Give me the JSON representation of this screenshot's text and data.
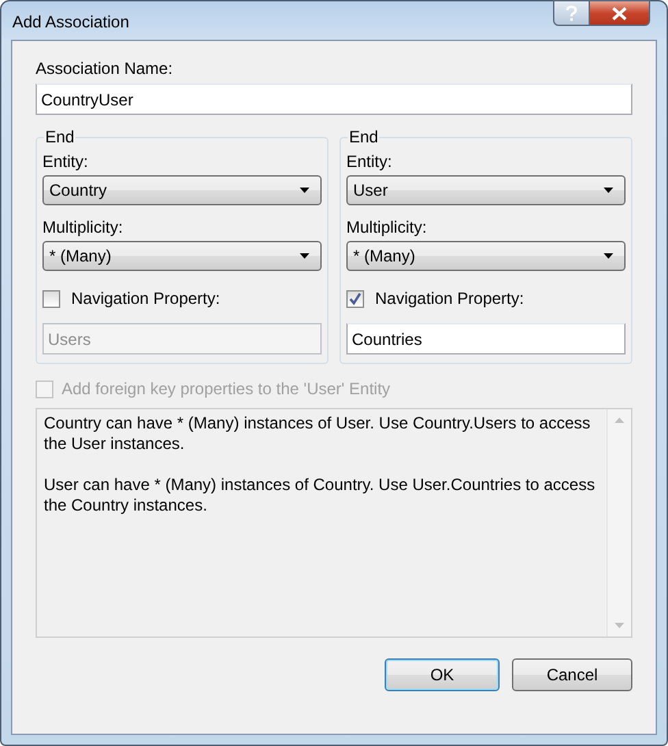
{
  "window": {
    "title": "Add Association"
  },
  "association_name": {
    "label": "Association Name:",
    "value": "CountryUser"
  },
  "ends": [
    {
      "legend": "End",
      "entity_label": "Entity:",
      "entity": "Country",
      "multiplicity_label": "Multiplicity:",
      "multiplicity": "* (Many)",
      "navigation_label": "Navigation Property:",
      "navigation_checked": false,
      "navigation_property": "Users",
      "navigation_disabled": true
    },
    {
      "legend": "End",
      "entity_label": "Entity:",
      "entity": "User",
      "multiplicity_label": "Multiplicity:",
      "multiplicity": "* (Many)",
      "navigation_label": "Navigation Property:",
      "navigation_checked": true,
      "navigation_property": "Countries",
      "navigation_disabled": false
    }
  ],
  "foreign_key": {
    "label": "Add foreign key properties to the 'User' Entity",
    "checked": false,
    "disabled": true
  },
  "description": [
    "Country can have * (Many) instances of User. Use Country.Users to access the User instances.",
    "User can have * (Many) instances of Country. Use User.Countries to access the Country instances."
  ],
  "buttons": [
    {
      "label": "OK",
      "default": true
    },
    {
      "label": "Cancel",
      "default": false
    }
  ]
}
